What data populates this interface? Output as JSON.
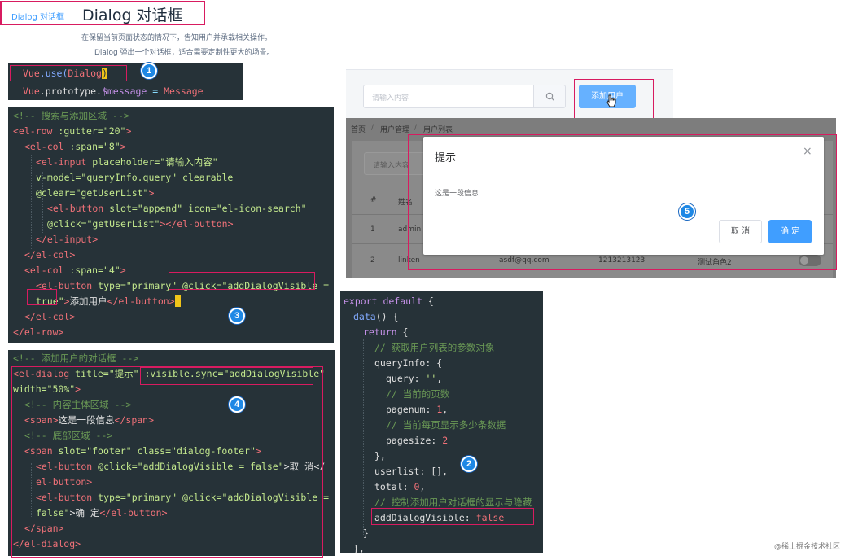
{
  "header": {
    "breadcrumb": "Dialog 对话框",
    "title": "Dialog 对话框",
    "desc1": "在保留当前页面状态的情况下，告知用户并承载相关操作。",
    "desc2": "Dialog 弹出一个对话框，适合需要定制性更大的场景。"
  },
  "code1": {
    "l1_vue": "Vue",
    "l1_use": ".use(",
    "l1_arg": "Dialog",
    "l1_close": ")",
    "l2_vue": "Vue",
    "l2_proto": ".prototype.",
    "l2_msg": "$message",
    "l2_eq": " = ",
    "l2_val": "Message"
  },
  "code3": {
    "c1": "<!-- 搜索与添加区域 -->",
    "l2a": "<el-row",
    "l2b": " :gutter=",
    "l2c": "\"20\"",
    "l2d": ">",
    "l3a": "<el-col",
    "l3b": " :span=",
    "l3c": "\"8\"",
    "l3d": ">",
    "l4a": "<el-input",
    "l4b": " placeholder=",
    "l4c": "\"请输入内容\"",
    "l5a": "v-model=",
    "l5b": "\"queryInfo.query\"",
    "l5c": " clearable",
    "l6a": "@clear=",
    "l6b": "\"getUserList\"",
    "l6c": ">",
    "l7a": "<el-button",
    "l7b": " slot=",
    "l7c": "\"append\"",
    "l7d": " icon=",
    "l7e": "\"el-icon-search\"",
    "l8a": "@click=",
    "l8b": "\"getUserList\"",
    "l8c": "></el-button>",
    "l9": "</el-input>",
    "l10": "</el-col>",
    "l11a": "<el-col",
    "l11b": " :span=",
    "l11c": "\"4\"",
    "l11d": ">",
    "l12a": "<el-button",
    "l12b": " type=",
    "l12c": "\"primary\"",
    "l12d": " @click=",
    "l12e": "\"addDialogVisible =",
    "l13a": "true\"",
    "l13b": ">",
    "l13c": "添加用户",
    "l13d": "</el-button>",
    "l14": "</el-col>",
    "l15": "</el-row>"
  },
  "code4": {
    "c1": "<!-- 添加用户的对话框 -->",
    "l2a": "<el-dialog",
    "l2b": " title=",
    "l2c": "\"提示\"",
    "l2d": " :visible.sync=",
    "l2e": "\"addDialogVisible\"",
    "l3a": "width=",
    "l3b": "\"50%\"",
    "l3c": ">",
    "c2": "<!-- 内容主体区域 -->",
    "l5a": "<span>",
    "l5b": "这是一段信息",
    "l5c": "</span>",
    "c3": "<!-- 底部区域 -->",
    "l7a": "<span",
    "l7b": " slot=",
    "l7c": "\"footer\"",
    "l7d": " class=",
    "l7e": "\"dialog-footer\"",
    "l7f": ">",
    "l8a": "<el-button",
    "l8b": " @click=",
    "l8c": "\"addDialogVisible = false\"",
    "l8d": ">取 消</",
    "l9": "el-button>",
    "l10a": "<el-button",
    "l10b": " type=",
    "l10c": "\"primary\"",
    "l10d": " @click=",
    "l10e": "\"addDialogVisible =",
    "l11a": "false\"",
    "l11b": ">确 定",
    "l11c": "</el-button>",
    "l12": "</span>",
    "l13": "</el-dialog>"
  },
  "code2": {
    "l1a": "export default",
    "l1b": " {",
    "l2a": "data",
    "l2b": "() {",
    "l3a": "return",
    "l3b": " {",
    "c1": "// 获取用户列表的参数对象",
    "l5a": "queryInfo",
    "l5b": ": {",
    "l6a": "query",
    "l6b": ": ",
    "l6c": "''",
    "l6d": ",",
    "c2": "// 当前的页数",
    "l8a": "pagenum",
    "l8b": ": ",
    "l8c": "1",
    "l8d": ",",
    "c3": "// 当前每页显示多少条数据",
    "l10a": "pagesize",
    "l10b": ": ",
    "l10c": "2",
    "l11": "},",
    "l12a": "userlist",
    "l12b": ": [],",
    "l13a": "total",
    "l13b": ": ",
    "l13c": "0",
    "l13d": ",",
    "c4": "// 控制添加用户对话框的显示与隐藏",
    "l15a": "addDialogVisible",
    "l15b": ": ",
    "l15c": "false",
    "l16": "}",
    "l17": "},"
  },
  "preview": {
    "search_placeholder": "请输入内容",
    "add_button": "添加用户",
    "bc_home": "首页",
    "bc_sep1": "/",
    "bc_user_mgmt": "用户管理",
    "bc_sep2": "/",
    "bc_user_list": "用户列表",
    "bg_search_placeholder": "请输入内容",
    "col_index": "#",
    "col_name": "姓名",
    "row1_index": "1",
    "row1_name": "admin",
    "row2_index": "2",
    "row2_name": "linken",
    "row2_email": "asdf@qq.com",
    "row2_phone": "1213213123",
    "row2_role": "测试角色2"
  },
  "dialog": {
    "title": "提示",
    "close": "×",
    "body": "这是一段信息",
    "cancel": "取 消",
    "confirm": "确 定"
  },
  "badges": {
    "b1": "1",
    "b2": "2",
    "b3": "3",
    "b4": "4",
    "b5": "5"
  },
  "watermark": "@稀土掘金技术社区",
  "colors": {
    "primary": "#409eff",
    "highlight": "#d81b60",
    "code_bg": "#263238",
    "badge": "#1e88e5"
  }
}
